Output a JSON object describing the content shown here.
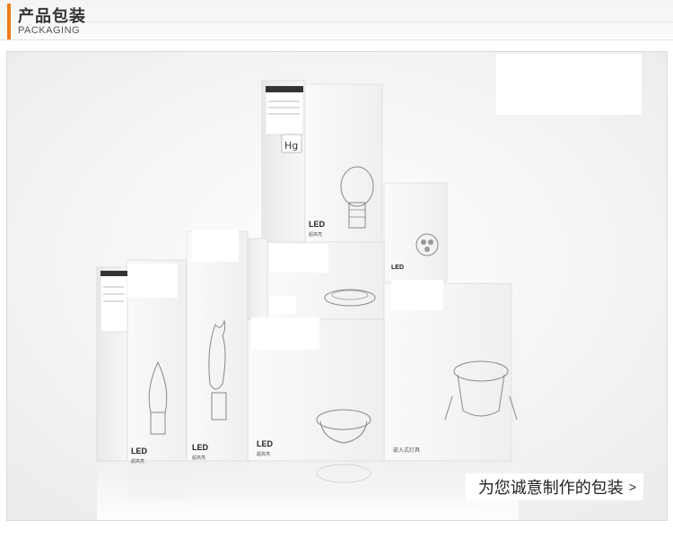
{
  "header": {
    "title_cn": "产品包装",
    "title_en": "PACKAGING"
  },
  "photo": {
    "box_label": "LED",
    "box_sublabel": "超高亮",
    "recessed_label": "嵌入式灯具",
    "hg_mark": "Hg",
    "caption": "为您诚意制作的包装",
    "caption_arrow": ">"
  },
  "colors": {
    "accent": "#f07a17"
  }
}
